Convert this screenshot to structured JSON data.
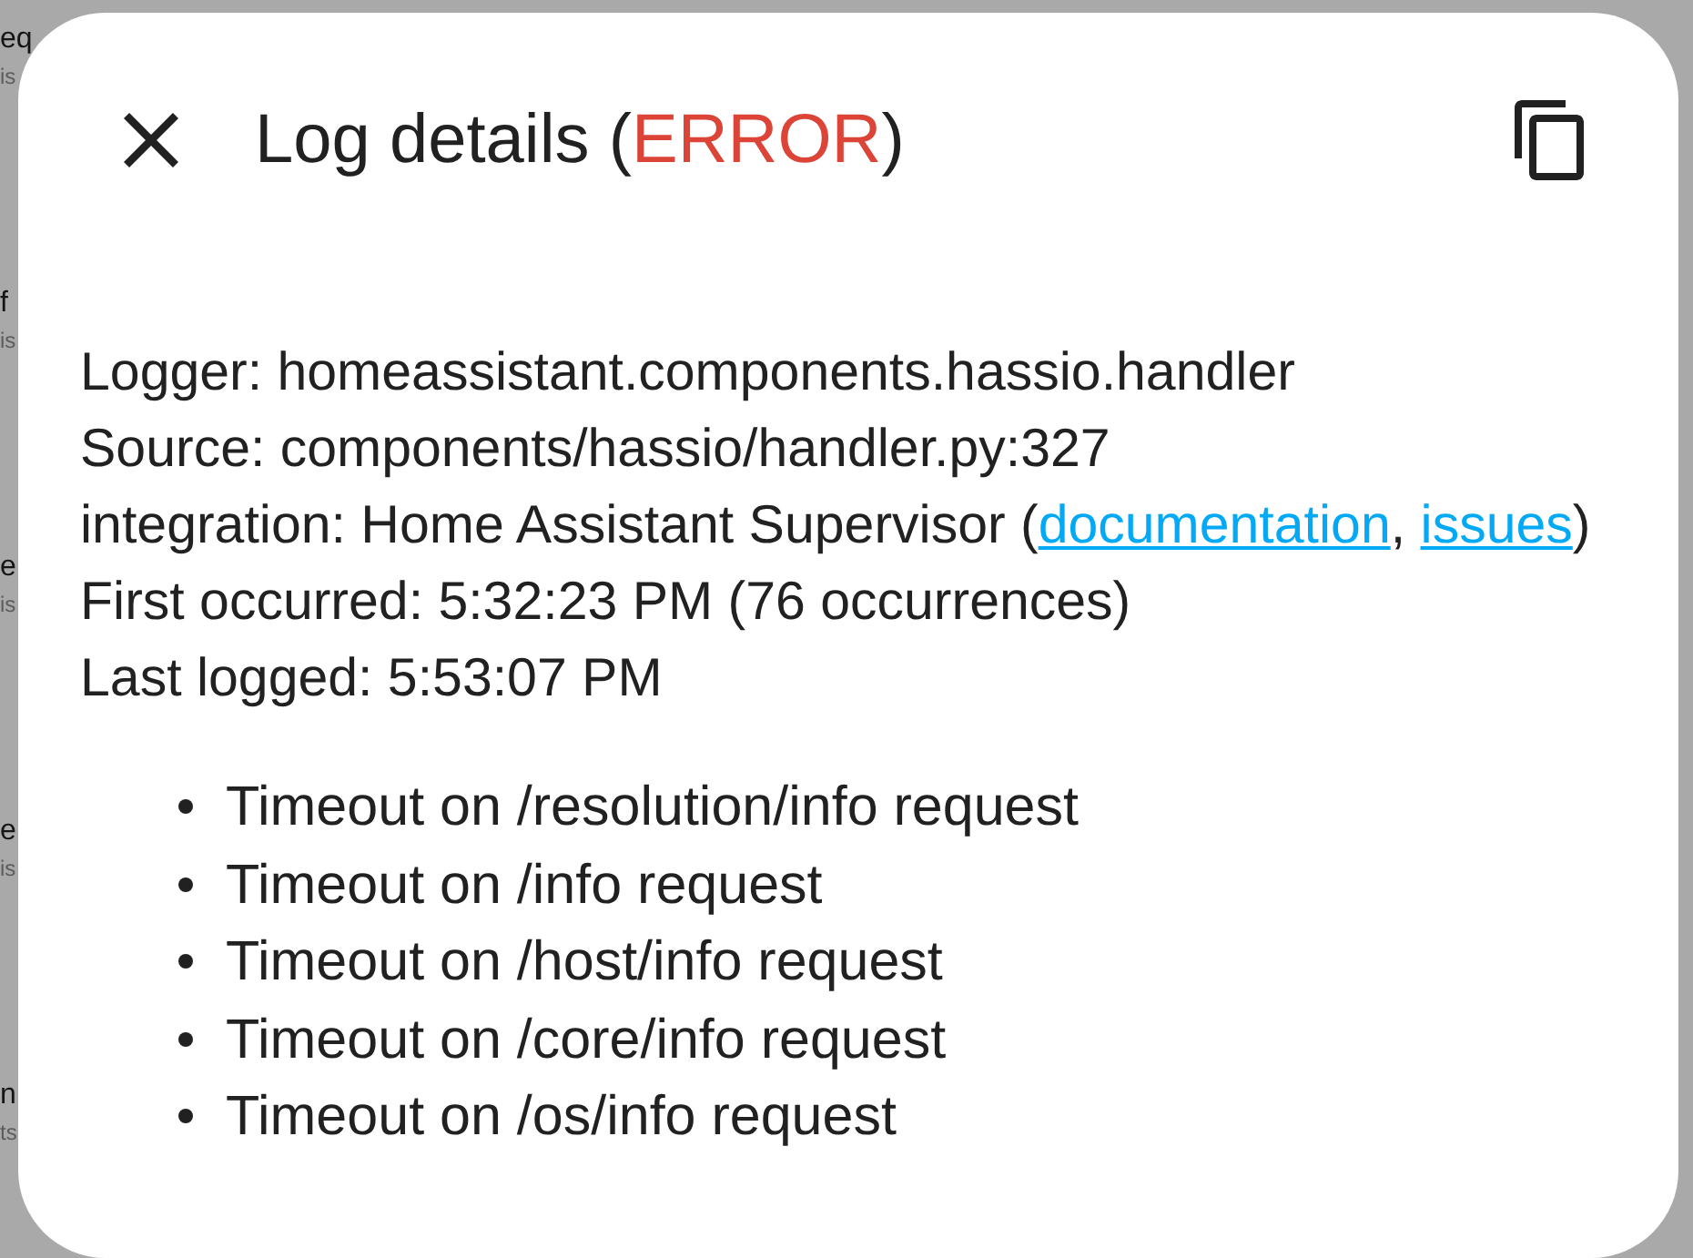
{
  "backdrop": {
    "list_items": [
      {
        "title": "eq",
        "subtitle": "is"
      },
      {
        "title": "f",
        "subtitle": "is"
      },
      {
        "title": "e",
        "subtitle": "is"
      },
      {
        "title": "e",
        "subtitle": "is"
      },
      {
        "title": "n",
        "subtitle": "ts"
      }
    ]
  },
  "dialog": {
    "title_parts": [
      {
        "kind": "text",
        "text": "Log details ("
      },
      {
        "kind": "severity",
        "text": "ERROR"
      },
      {
        "kind": "text",
        "text": ")"
      }
    ],
    "details": [
      {
        "parts": [
          {
            "kind": "text",
            "text": "Logger: homeassistant.components.hassio.handler"
          }
        ]
      },
      {
        "parts": [
          {
            "kind": "text",
            "text": "Source: components/hassio/handler.py:327"
          }
        ]
      },
      {
        "parts": [
          {
            "kind": "text",
            "text": "integration: Home Assistant Supervisor ("
          },
          {
            "kind": "link",
            "text": "documentation",
            "after": ", "
          },
          {
            "kind": "link",
            "text": "issues",
            "after": ")"
          }
        ]
      },
      {
        "parts": [
          {
            "kind": "text",
            "text": "First occurred: 5:32:23 PM (76 occurrences)"
          }
        ]
      },
      {
        "parts": [
          {
            "kind": "text",
            "text": "Last logged: 5:53:07 PM"
          }
        ]
      }
    ],
    "messages": [
      "Timeout on /resolution/info request",
      "Timeout on /info request",
      "Timeout on /host/info request",
      "Timeout on /core/info request",
      "Timeout on /os/info request"
    ]
  }
}
